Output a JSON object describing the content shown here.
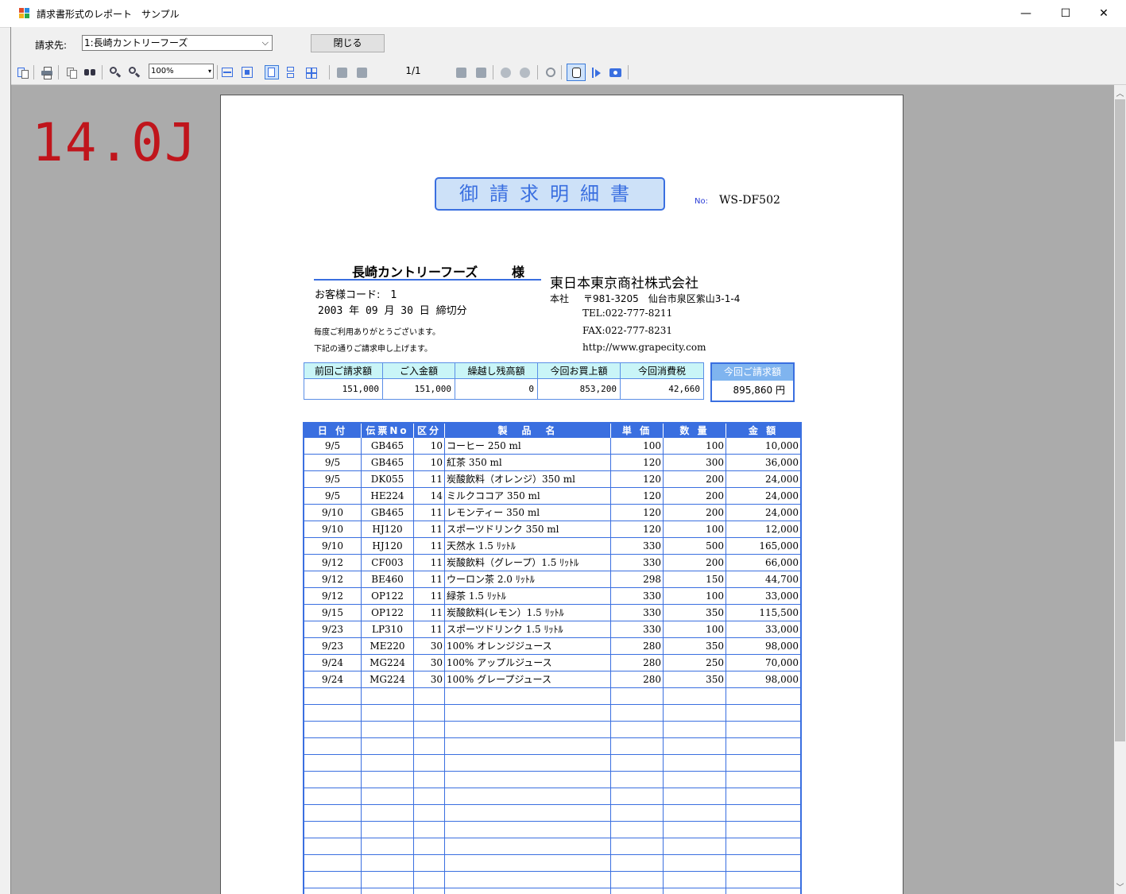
{
  "window": {
    "title": "請求書形式のレポート　サンプル",
    "controls": {
      "minimize": "—",
      "maximize": "☐",
      "close": "✕"
    }
  },
  "topbar": {
    "recipient_label": "請求先:",
    "recipient_value": "1:長崎カントリーフーズ",
    "close_label": "閉じる"
  },
  "toolbar": {
    "zoom_value": "100%",
    "page_indicator": "1/1",
    "icons": [
      "toc-icon",
      "print-icon",
      "copy-icon",
      "find-icon",
      "zoom-out-icon",
      "zoom-in-icon",
      "fit-width-icon",
      "fit-page-icon",
      "single-page-icon",
      "continuous-icon",
      "multi-page-icon",
      "first-page-icon",
      "prev-page-icon",
      "next-page-icon",
      "last-page-icon",
      "back-icon",
      "forward-icon",
      "refresh-icon",
      "pan-icon",
      "select-icon",
      "snapshot-icon"
    ]
  },
  "watermark": {
    "version": "14.0J"
  },
  "invoice": {
    "title": "御請求明細書",
    "no_label": "No:",
    "no_value": "WS-DF502",
    "customer_name": "長崎カントリーフーズ",
    "honorific": "様",
    "customer_code": "お客様コード:　1",
    "closing_date": "2003 年 09 月 30 日 締切分",
    "thanks_line1": "毎度ご利用ありがとうございます。",
    "thanks_line2": "下記の通りご請求申し上げます。",
    "company": "東日本東京商社株式会社",
    "hq_label": "本社",
    "hq_address": "〒981-3205　仙台市泉区紫山3-1-4",
    "tel": "TEL:022-777-8211",
    "fax": "FAX:022-777-8231",
    "url": "http://www.grapecity.com",
    "summary": {
      "headers": [
        "前回ご請求額",
        "ご入金額",
        "繰越し残高額",
        "今回お買上額",
        "今回消費税"
      ],
      "values": [
        "151,000",
        "151,000",
        "0",
        "853,200",
        "42,660"
      ]
    },
    "total": {
      "header": "今回ご請求額",
      "value": "895,860 円"
    },
    "detail": {
      "headers": [
        "日 付",
        "伝票No",
        "区分",
        "製　品　名",
        "単 価",
        "数 量",
        "金 額"
      ],
      "rows": [
        [
          "9/5",
          "GB465",
          "10",
          "コーヒー 250 ml",
          "100",
          "100",
          "10,000"
        ],
        [
          "9/5",
          "GB465",
          "10",
          "紅茶 350 ml",
          "120",
          "300",
          "36,000"
        ],
        [
          "9/5",
          "DK055",
          "11",
          "炭酸飲料（オレンジ）350 ml",
          "120",
          "200",
          "24,000"
        ],
        [
          "9/5",
          "HE224",
          "14",
          "ミルクココア 350 ml",
          "120",
          "200",
          "24,000"
        ],
        [
          "9/10",
          "GB465",
          "11",
          "レモンティー 350 ml",
          "120",
          "200",
          "24,000"
        ],
        [
          "9/10",
          "HJ120",
          "11",
          "スポーツドリンク 350 ml",
          "120",
          "100",
          "12,000"
        ],
        [
          "9/10",
          "HJ120",
          "11",
          "天然水 1.5 ﾘｯﾄﾙ",
          "330",
          "500",
          "165,000"
        ],
        [
          "9/12",
          "CF003",
          "11",
          "炭酸飲料（グレープ）1.5 ﾘｯﾄﾙ",
          "330",
          "200",
          "66,000"
        ],
        [
          "9/12",
          "BE460",
          "11",
          "ウーロン茶 2.0 ﾘｯﾄﾙ",
          "298",
          "150",
          "44,700"
        ],
        [
          "9/12",
          "OP122",
          "11",
          "緑茶 1.5 ﾘｯﾄﾙ",
          "330",
          "100",
          "33,000"
        ],
        [
          "9/15",
          "OP122",
          "11",
          "炭酸飲料(レモン）1.5 ﾘｯﾄﾙ",
          "330",
          "350",
          "115,500"
        ],
        [
          "9/23",
          "LP310",
          "11",
          "スポーツドリンク 1.5 ﾘｯﾄﾙ",
          "330",
          "100",
          "33,000"
        ],
        [
          "9/23",
          "ME220",
          "30",
          "100% オレンジジュース",
          "280",
          "350",
          "98,000"
        ],
        [
          "9/24",
          "MG224",
          "30",
          "100% アップルジュース",
          "280",
          "250",
          "70,000"
        ],
        [
          "9/24",
          "MG224",
          "30",
          "100% グレープジュース",
          "280",
          "350",
          "98,000"
        ]
      ],
      "empty_rows": 13
    }
  },
  "colors": {
    "accent": "#3a6fe0",
    "summary_header": "#c9f5f7",
    "version_red": "#c0151c",
    "viewport_bg": "#ababab"
  }
}
